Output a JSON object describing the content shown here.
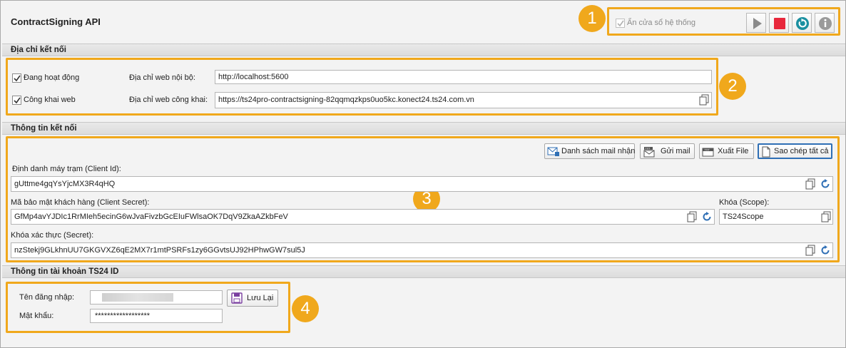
{
  "app": {
    "title": "ContractSigning API"
  },
  "toolbar": {
    "hide_window_label": "Ẩn cửa sổ hệ thống",
    "hide_window_checked": true,
    "buttons": [
      "play-icon",
      "stop-icon",
      "refresh-icon",
      "info-icon"
    ]
  },
  "badges": [
    "1",
    "2",
    "3",
    "4"
  ],
  "connection_address": {
    "header": "Địa chỉ kết nối",
    "active_label": "Đang hoạt động",
    "active_checked": true,
    "public_label": "Công khai web",
    "public_checked": true,
    "internal_url_label": "Địa chỉ web nội bộ:",
    "internal_url_value": "http://localhost:5600",
    "public_url_label": "Địa chỉ web công khai:",
    "public_url_value": "https://ts24pro-contractsigning-82qqmqzkps0uo5kc.konect24.ts24.com.vn"
  },
  "connection_info": {
    "header": "Thông tin kết nối",
    "buttons": {
      "mail_list": "Danh sách mail nhận",
      "send_mail": "Gửi mail",
      "export_file": "Xuất File",
      "copy_all": "Sao chép tất cả"
    },
    "client_id_label": "Định danh máy trạm (Client Id):",
    "client_id_value": "gUttme4gqYsYjcMX3R4qHQ",
    "client_secret_label": "Mã bảo mật khách hàng (Client Secret):",
    "client_secret_value": "GfMp4avYJDIc1RrMIeh5ecinG6wJvaFivzbGcEIuFWlsaOK7DqV9ZkaAZkbFeV",
    "scope_label": "Khóa (Scope):",
    "scope_value": "TS24Scope",
    "secret_label": "Khóa xác thực (Secret):",
    "secret_value": "nzStekj9GLkhnUU7GKGVXZ6qE2MX7r1mtPSRFs1zy6GGvtsUJ92HPhwGW7sul5J"
  },
  "account": {
    "header": "Thông tin tài khoản TS24 ID",
    "username_label": "Tên đăng nhập:",
    "password_label": "Mật khẩu:",
    "password_value": "******************",
    "save_label": "Lưu Lại"
  },
  "colors": {
    "accent_orange": "#f0a81c",
    "stop_red": "#e8283c",
    "refresh_teal": "#1a8fa0",
    "icon_blue": "#2f6fb5"
  }
}
